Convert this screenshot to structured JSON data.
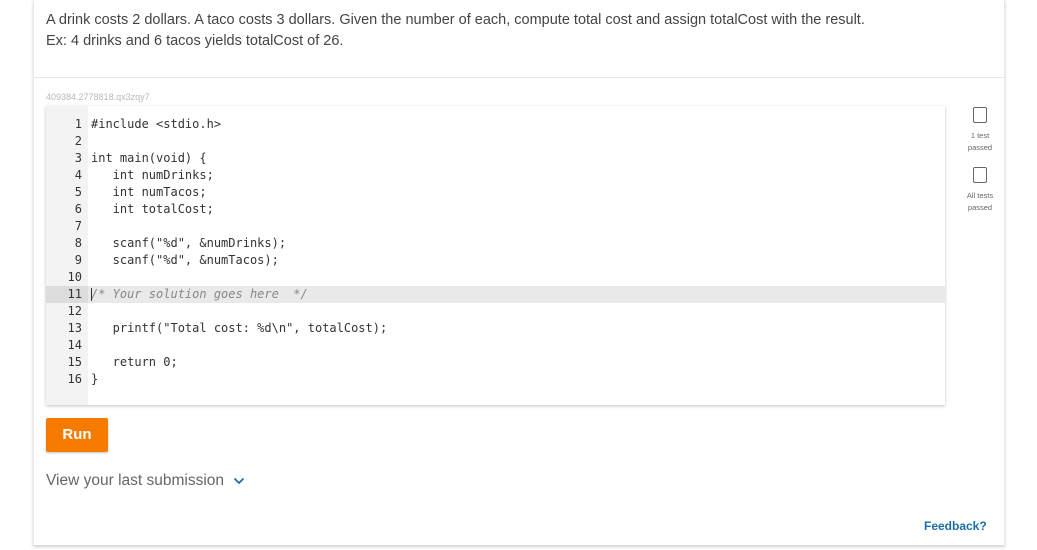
{
  "prompt": {
    "line1": "A drink costs 2 dollars. A taco costs 3 dollars. Given the number of each, compute total cost and assign totalCost with the result.",
    "line2": "Ex: 4 drinks and 6 tacos yields totalCost of 26."
  },
  "challenge_id": "409384.2778818.qx3zqy7",
  "editor": {
    "active_line": 11,
    "lines": [
      {
        "num": "1",
        "code": "#include <stdio.h>"
      },
      {
        "num": "2",
        "code": ""
      },
      {
        "num": "3",
        "code": "int main(void) {"
      },
      {
        "num": "4",
        "code": "   int numDrinks;"
      },
      {
        "num": "5",
        "code": "   int numTacos;"
      },
      {
        "num": "6",
        "code": "   int totalCost;"
      },
      {
        "num": "7",
        "code": ""
      },
      {
        "num": "8",
        "code": "   scanf(\"%d\", &numDrinks);"
      },
      {
        "num": "9",
        "code": "   scanf(\"%d\", &numTacos);"
      },
      {
        "num": "10",
        "code": ""
      },
      {
        "num": "11",
        "code": "/* Your solution goes here  */"
      },
      {
        "num": "12",
        "code": ""
      },
      {
        "num": "13",
        "code": "   printf(\"Total cost: %d\\n\", totalCost);"
      },
      {
        "num": "14",
        "code": ""
      },
      {
        "num": "15",
        "code": "   return 0;"
      },
      {
        "num": "16",
        "code": "}"
      }
    ]
  },
  "run_button_label": "Run",
  "view_submission_label": "View your last submission",
  "feedback_label": "Feedback?",
  "tests": [
    {
      "label_line1": "1 test",
      "label_line2": "passed",
      "passed": false
    },
    {
      "label_line1": "All tests",
      "label_line2": "passed",
      "passed": false
    }
  ],
  "colors": {
    "accent": "#f47b00",
    "link": "#1a6fa8"
  }
}
